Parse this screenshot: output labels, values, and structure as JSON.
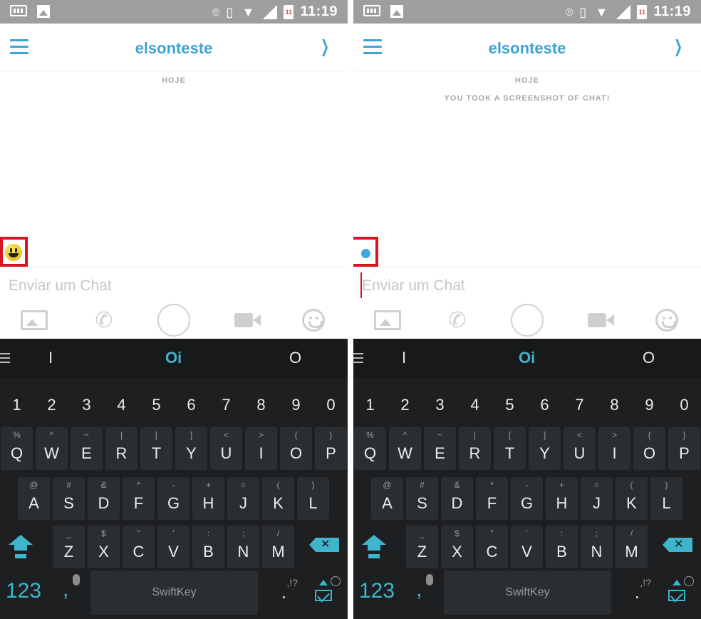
{
  "status_bar": {
    "time": "11:19",
    "battery_label": "11"
  },
  "header": {
    "title": "elsonteste"
  },
  "day_label": "HOJE",
  "system_message": "YOU TOOK A SCREENSHOT OF CHAT!",
  "composer": {
    "placeholder": "Enviar um Chat"
  },
  "keyboard": {
    "suggestions": [
      "I",
      "Oi",
      "O"
    ],
    "numbers": [
      "1",
      "2",
      "3",
      "4",
      "5",
      "6",
      "7",
      "8",
      "9",
      "0"
    ],
    "row1": [
      {
        "k": "Q",
        "h": "%"
      },
      {
        "k": "W",
        "h": "^"
      },
      {
        "k": "E",
        "h": "~"
      },
      {
        "k": "R",
        "h": "|"
      },
      {
        "k": "T",
        "h": "["
      },
      {
        "k": "Y",
        "h": "]"
      },
      {
        "k": "U",
        "h": "<"
      },
      {
        "k": "I",
        "h": ">"
      },
      {
        "k": "O",
        "h": "{"
      },
      {
        "k": "P",
        "h": "}"
      }
    ],
    "row2": [
      {
        "k": "A",
        "h": "@"
      },
      {
        "k": "S",
        "h": "#"
      },
      {
        "k": "D",
        "h": "&"
      },
      {
        "k": "F",
        "h": "*"
      },
      {
        "k": "G",
        "h": "-"
      },
      {
        "k": "H",
        "h": "+"
      },
      {
        "k": "J",
        "h": "="
      },
      {
        "k": "K",
        "h": "("
      },
      {
        "k": "L",
        "h": ")"
      }
    ],
    "row3": [
      {
        "k": "Z",
        "h": "_"
      },
      {
        "k": "X",
        "h": "$"
      },
      {
        "k": "C",
        "h": "\""
      },
      {
        "k": "V",
        "h": "'"
      },
      {
        "k": "B",
        "h": ":"
      },
      {
        "k": "N",
        "h": ";"
      },
      {
        "k": "M",
        "h": "/"
      }
    ],
    "num_switch_label": "123",
    "comma_label": ",",
    "space_brand": "SwiftKey",
    "punct_hint": ",!?",
    "period_label": "."
  },
  "colors": {
    "accent": "#3da3d6",
    "keyboard_accent": "#3fb5cc",
    "highlight_box": "#d8161f"
  }
}
